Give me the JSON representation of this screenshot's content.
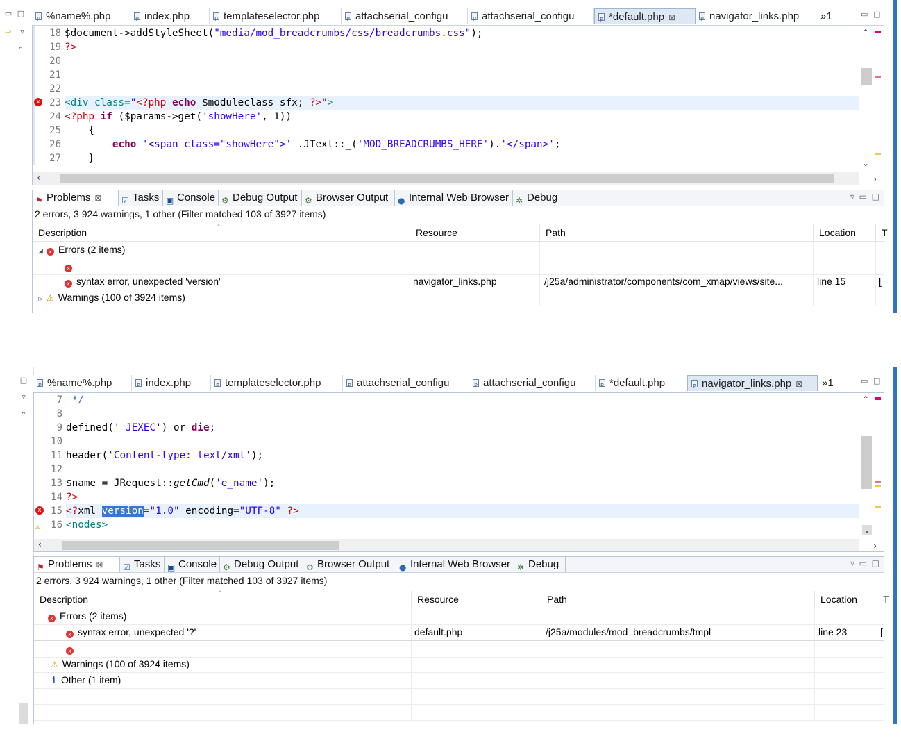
{
  "editor_tabs": [
    "%name%.php",
    "index.php",
    "templateselector.php",
    "attachserial_configu",
    "attachserial_configu",
    "*default.php",
    "navigator_links.php"
  ],
  "tab_overflow": "»1",
  "view_tabs": [
    "Problems",
    "Tasks",
    "Console",
    "Debug Output",
    "Browser Output",
    "Internal Web Browser",
    "Debug"
  ],
  "summary": "2 errors, 3 924 warnings, 1 other (Filter matched 103 of 3927 items)",
  "columns": [
    "Description",
    "Resource",
    "Path",
    "Location",
    "T"
  ],
  "errors_group": "Errors (2 items)",
  "warnings_group": "Warnings (100 of 3924 items)",
  "other_group": "Other (1 item)",
  "errors": [
    {
      "desc": "syntax error, unexpected '?'",
      "resource": "default.php",
      "path": "/j25a/modules/mod_breadcrumbs/tmpl",
      "location": "line 23",
      "type": "["
    },
    {
      "desc": "syntax error, unexpected 'version'",
      "resource": "navigator_links.php",
      "path": "/j25a/administrator/components/com_xmap/views/site...",
      "location": "line 15",
      "type": "["
    }
  ],
  "top_panel": {
    "active_tab": 5,
    "line_numbers": [
      "18",
      "19",
      "20",
      "21",
      "22",
      "23",
      "24",
      "25",
      "26",
      "27"
    ],
    "error_line_index": 5
  },
  "bottom_panel": {
    "active_tab": 6,
    "line_numbers": [
      "7",
      "8",
      "9",
      "10",
      "11",
      "12",
      "13",
      "14",
      "15",
      "16"
    ],
    "error_line_index": 8,
    "warning_line_index": 9
  }
}
